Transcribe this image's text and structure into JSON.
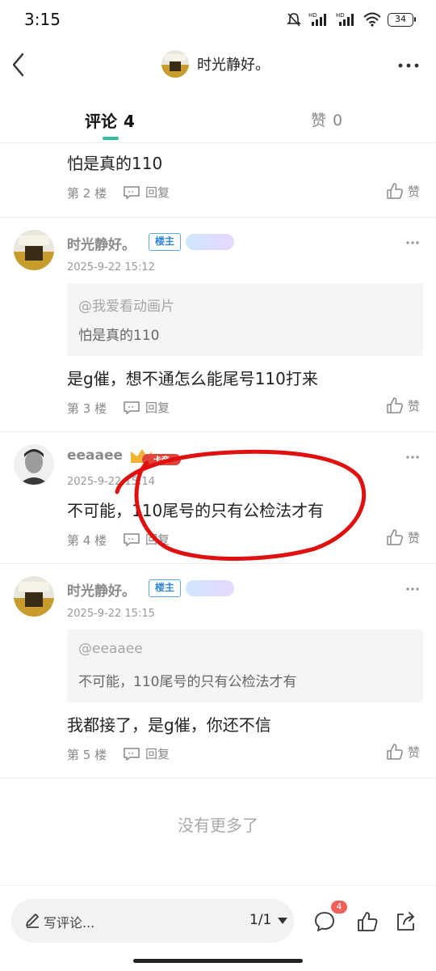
{
  "status_bar": {
    "time": "3:15",
    "battery": "34",
    "signal_label_1": "HD",
    "signal_label_2": "HD"
  },
  "header": {
    "title": "时光静好。"
  },
  "tabs": {
    "comments_label": "评论",
    "comments_count": "4",
    "likes_label": "赞",
    "likes_count": "0"
  },
  "comments": [
    {
      "body": "怕是真的110",
      "floor": "第 2 楼",
      "reply_label": "回复",
      "like_label": "赞"
    },
    {
      "name": "时光静好。",
      "badge": "楼主",
      "time": "2025-9-22 15:12",
      "quote_user": "@我爱看动画片",
      "quote_text": "怕是真的110",
      "body": "是g催，想不通怎么能尾号110打来",
      "floor": "第 3 楼",
      "reply_label": "回复",
      "like_label": "赞"
    },
    {
      "name": "eeaaee",
      "badge": "卡帝",
      "time": "2025-9-22 15:14",
      "body": "不可能，110尾号的只有公检法才有",
      "floor": "第 4 楼",
      "reply_label": "回复",
      "like_label": "赞"
    },
    {
      "name": "时光静好。",
      "badge": "楼主",
      "time": "2025-9-22 15:15",
      "quote_user": "@eeaaee",
      "quote_text": "不可能，110尾号的只有公检法才有",
      "body": "我都接了，是g催，你还不信",
      "floor": "第 5 楼",
      "reply_label": "回复",
      "like_label": "赞"
    }
  ],
  "footer": {
    "no_more": "没有更多了"
  },
  "bottom_bar": {
    "placeholder": "写评论...",
    "page": "1/1",
    "chat_badge": "4"
  },
  "colors": {
    "accent": "#2bbf9a",
    "host_badge": "#2f86d6",
    "annotation": "#e01010",
    "chat_badge": "#f3605a"
  }
}
